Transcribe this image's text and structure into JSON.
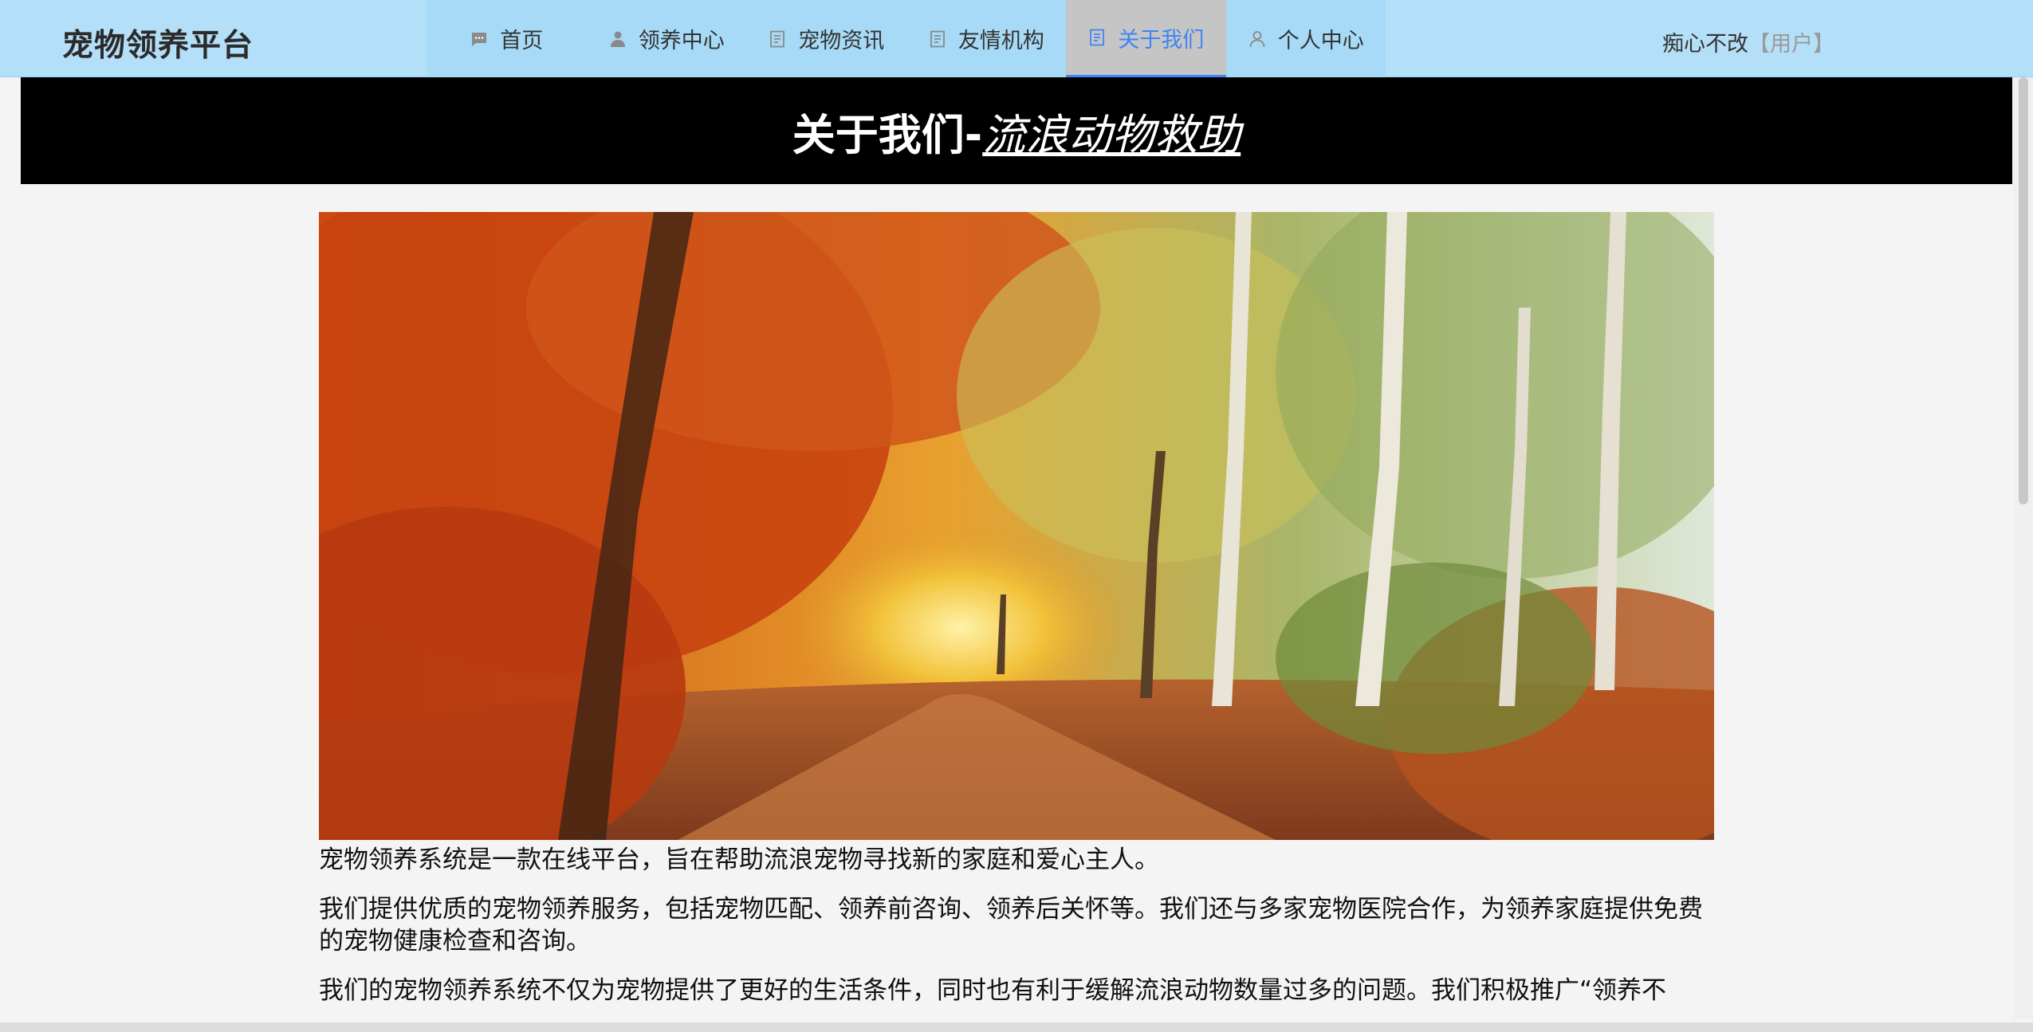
{
  "header": {
    "brand": "宠物领养平台",
    "nav": [
      {
        "label": "首页",
        "icon": "chat-icon",
        "active": false
      },
      {
        "label": "领养中心",
        "icon": "person-icon",
        "active": false
      },
      {
        "label": "宠物资讯",
        "icon": "document-icon",
        "active": false
      },
      {
        "label": "友情机构",
        "icon": "document-icon",
        "active": false
      },
      {
        "label": "关于我们",
        "icon": "document-icon",
        "active": true
      },
      {
        "label": "个人中心",
        "icon": "user-outline-icon",
        "active": false
      }
    ],
    "user": {
      "name": "痴心不改",
      "role": "【用户】"
    }
  },
  "page": {
    "title_main": "关于我们-",
    "title_sub": "流浪动物救助",
    "hero_image": "autumn-forest-path-image",
    "paragraphs": [
      "宠物领养系统是一款在线平台，旨在帮助流浪宠物寻找新的家庭和爱心主人。",
      "我们提供优质的宠物领养服务，包括宠物匹配、领养前咨询、领养后关怀等。我们还与多家宠物医院合作，为领养家庭提供免费的宠物健康检查和咨询。",
      "我们的宠物领养系统不仅为宠物提供了更好的生活条件，同时也有利于缓解流浪动物数量过多的问题。我们积极推广“领养不"
    ]
  },
  "colors": {
    "header_bg": "#b3dff8",
    "menu_bg": "#a7daf6",
    "active_bg": "#c5c5c5",
    "accent": "#3f85f5",
    "title_bg": "#000000"
  }
}
